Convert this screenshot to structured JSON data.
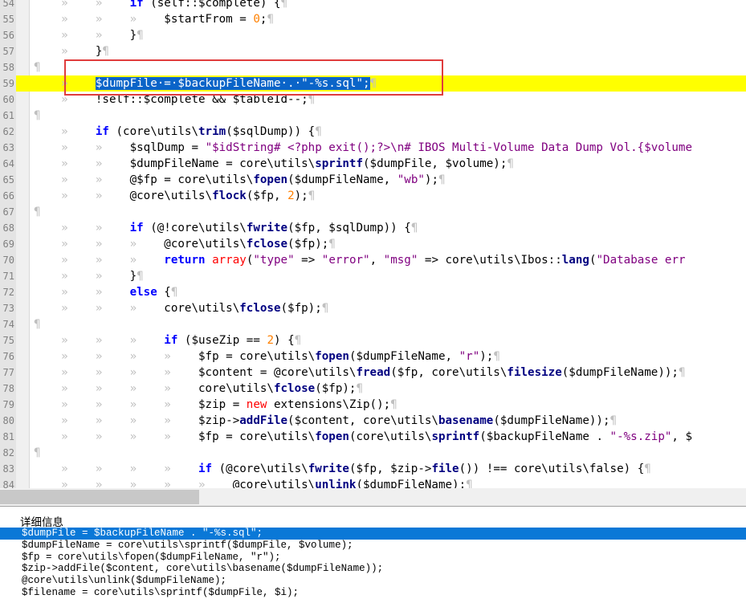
{
  "editor": {
    "lines": [
      {
        "num": "54",
        "tokens": [
          {
            "c": "ws",
            "t": "    »    »    "
          },
          {
            "c": "kw",
            "t": "if"
          },
          {
            "c": "df",
            "t": " (self::$complete) {"
          },
          {
            "c": "ws",
            "t": "¶"
          }
        ]
      },
      {
        "num": "55",
        "tokens": [
          {
            "c": "ws",
            "t": "    »    »    »    "
          },
          {
            "c": "df",
            "t": "$startFrom = "
          },
          {
            "c": "nm",
            "t": "0"
          },
          {
            "c": "df",
            "t": ";"
          },
          {
            "c": "ws",
            "t": "¶"
          }
        ]
      },
      {
        "num": "56",
        "tokens": [
          {
            "c": "ws",
            "t": "    »    »    "
          },
          {
            "c": "df",
            "t": "}"
          },
          {
            "c": "ws",
            "t": "¶"
          }
        ]
      },
      {
        "num": "57",
        "tokens": [
          {
            "c": "ws",
            "t": "    »    "
          },
          {
            "c": "df",
            "t": "}"
          },
          {
            "c": "ws",
            "t": "¶"
          }
        ]
      },
      {
        "num": "58",
        "tokens": [
          {
            "c": "ws",
            "t": "¶"
          }
        ]
      },
      {
        "num": "59",
        "highlight": true,
        "tokens": [
          {
            "c": "ws",
            "t": "    »    "
          },
          {
            "c": "sel",
            "t": "$dumpFile·=·$backupFileName·.·\"-%s.sql\";"
          },
          {
            "c": "ws",
            "t": "¶"
          }
        ]
      },
      {
        "num": "60",
        "tokens": [
          {
            "c": "ws",
            "t": "    »    "
          },
          {
            "c": "df",
            "t": "!self::$complete && $tableId--;"
          },
          {
            "c": "ws",
            "t": "¶"
          }
        ]
      },
      {
        "num": "61",
        "tokens": [
          {
            "c": "ws",
            "t": "¶"
          }
        ]
      },
      {
        "num": "62",
        "tokens": [
          {
            "c": "ws",
            "t": "    »    "
          },
          {
            "c": "kw",
            "t": "if"
          },
          {
            "c": "df",
            "t": " (core\\utils\\"
          },
          {
            "c": "op",
            "t": "trim"
          },
          {
            "c": "df",
            "t": "($sqlDump)) {"
          },
          {
            "c": "ws",
            "t": "¶"
          }
        ]
      },
      {
        "num": "63",
        "tokens": [
          {
            "c": "ws",
            "t": "    »    »    "
          },
          {
            "c": "df",
            "t": "$sqlDump = "
          },
          {
            "c": "sq",
            "t": "\"$idString# <?php exit();?>\\n# IBOS Multi-Volume Data Dump Vol.{$volume"
          }
        ]
      },
      {
        "num": "64",
        "tokens": [
          {
            "c": "ws",
            "t": "    »    »    "
          },
          {
            "c": "df",
            "t": "$dumpFileName = core\\utils\\"
          },
          {
            "c": "op",
            "t": "sprintf"
          },
          {
            "c": "df",
            "t": "($dumpFile, $volume);"
          },
          {
            "c": "ws",
            "t": "¶"
          }
        ]
      },
      {
        "num": "65",
        "tokens": [
          {
            "c": "ws",
            "t": "    »    »    "
          },
          {
            "c": "df",
            "t": "@$fp = core\\utils\\"
          },
          {
            "c": "op",
            "t": "fopen"
          },
          {
            "c": "df",
            "t": "($dumpFileName, "
          },
          {
            "c": "sq",
            "t": "\"wb\""
          },
          {
            "c": "df",
            "t": ");"
          },
          {
            "c": "ws",
            "t": "¶"
          }
        ]
      },
      {
        "num": "66",
        "tokens": [
          {
            "c": "ws",
            "t": "    »    »    "
          },
          {
            "c": "df",
            "t": "@core\\utils\\"
          },
          {
            "c": "op",
            "t": "flock"
          },
          {
            "c": "df",
            "t": "($fp, "
          },
          {
            "c": "nm",
            "t": "2"
          },
          {
            "c": "df",
            "t": ");"
          },
          {
            "c": "ws",
            "t": "¶"
          }
        ]
      },
      {
        "num": "67",
        "tokens": [
          {
            "c": "ws",
            "t": "¶"
          }
        ]
      },
      {
        "num": "68",
        "tokens": [
          {
            "c": "ws",
            "t": "    »    »    "
          },
          {
            "c": "kw",
            "t": "if"
          },
          {
            "c": "df",
            "t": " (@!core\\utils\\"
          },
          {
            "c": "op",
            "t": "fwrite"
          },
          {
            "c": "df",
            "t": "($fp, $sqlDump)) {"
          },
          {
            "c": "ws",
            "t": "¶"
          }
        ]
      },
      {
        "num": "69",
        "tokens": [
          {
            "c": "ws",
            "t": "    »    »    »    "
          },
          {
            "c": "df",
            "t": "@core\\utils\\"
          },
          {
            "c": "op",
            "t": "fclose"
          },
          {
            "c": "df",
            "t": "($fp);"
          },
          {
            "c": "ws",
            "t": "¶"
          }
        ]
      },
      {
        "num": "70",
        "tokens": [
          {
            "c": "ws",
            "t": "    »    »    »    "
          },
          {
            "c": "kw",
            "t": "return"
          },
          {
            "c": "df",
            "t": " "
          },
          {
            "c": "kw2",
            "t": "array"
          },
          {
            "c": "df",
            "t": "("
          },
          {
            "c": "sq",
            "t": "\"type\""
          },
          {
            "c": "df",
            "t": " => "
          },
          {
            "c": "sq",
            "t": "\"error\""
          },
          {
            "c": "df",
            "t": ", "
          },
          {
            "c": "sq",
            "t": "\"msg\""
          },
          {
            "c": "df",
            "t": " => core\\utils\\Ibos::"
          },
          {
            "c": "op",
            "t": "lang"
          },
          {
            "c": "df",
            "t": "("
          },
          {
            "c": "sq",
            "t": "\"Database err"
          }
        ]
      },
      {
        "num": "71",
        "tokens": [
          {
            "c": "ws",
            "t": "    »    »    "
          },
          {
            "c": "df",
            "t": "}"
          },
          {
            "c": "ws",
            "t": "¶"
          }
        ]
      },
      {
        "num": "72",
        "tokens": [
          {
            "c": "ws",
            "t": "    »    »    "
          },
          {
            "c": "kw",
            "t": "else"
          },
          {
            "c": "df",
            "t": " {"
          },
          {
            "c": "ws",
            "t": "¶"
          }
        ]
      },
      {
        "num": "73",
        "tokens": [
          {
            "c": "ws",
            "t": "    »    »    »    "
          },
          {
            "c": "df",
            "t": "core\\utils\\"
          },
          {
            "c": "op",
            "t": "fclose"
          },
          {
            "c": "df",
            "t": "($fp);"
          },
          {
            "c": "ws",
            "t": "¶"
          }
        ]
      },
      {
        "num": "74",
        "tokens": [
          {
            "c": "ws",
            "t": "¶"
          }
        ]
      },
      {
        "num": "75",
        "tokens": [
          {
            "c": "ws",
            "t": "    »    »    »    "
          },
          {
            "c": "kw",
            "t": "if"
          },
          {
            "c": "df",
            "t": " ($useZip == "
          },
          {
            "c": "nm",
            "t": "2"
          },
          {
            "c": "df",
            "t": ") {"
          },
          {
            "c": "ws",
            "t": "¶"
          }
        ]
      },
      {
        "num": "76",
        "tokens": [
          {
            "c": "ws",
            "t": "    »    »    »    »    "
          },
          {
            "c": "df",
            "t": "$fp = core\\utils\\"
          },
          {
            "c": "op",
            "t": "fopen"
          },
          {
            "c": "df",
            "t": "($dumpFileName, "
          },
          {
            "c": "sq",
            "t": "\"r\""
          },
          {
            "c": "df",
            "t": ");"
          },
          {
            "c": "ws",
            "t": "¶"
          }
        ]
      },
      {
        "num": "77",
        "tokens": [
          {
            "c": "ws",
            "t": "    »    »    »    »    "
          },
          {
            "c": "df",
            "t": "$content = @core\\utils\\"
          },
          {
            "c": "op",
            "t": "fread"
          },
          {
            "c": "df",
            "t": "($fp, core\\utils\\"
          },
          {
            "c": "op",
            "t": "filesize"
          },
          {
            "c": "df",
            "t": "($dumpFileName));"
          },
          {
            "c": "ws",
            "t": "¶"
          }
        ]
      },
      {
        "num": "78",
        "tokens": [
          {
            "c": "ws",
            "t": "    »    »    »    »    "
          },
          {
            "c": "df",
            "t": "core\\utils\\"
          },
          {
            "c": "op",
            "t": "fclose"
          },
          {
            "c": "df",
            "t": "($fp);"
          },
          {
            "c": "ws",
            "t": "¶"
          }
        ]
      },
      {
        "num": "79",
        "tokens": [
          {
            "c": "ws",
            "t": "    »    »    »    »    "
          },
          {
            "c": "df",
            "t": "$zip = "
          },
          {
            "c": "kw2",
            "t": "new"
          },
          {
            "c": "df",
            "t": " extensions\\Zip();"
          },
          {
            "c": "ws",
            "t": "¶"
          }
        ]
      },
      {
        "num": "80",
        "tokens": [
          {
            "c": "ws",
            "t": "    »    »    »    »    "
          },
          {
            "c": "df",
            "t": "$zip->"
          },
          {
            "c": "op",
            "t": "addFile"
          },
          {
            "c": "df",
            "t": "($content, core\\utils\\"
          },
          {
            "c": "op",
            "t": "basename"
          },
          {
            "c": "df",
            "t": "($dumpFileName));"
          },
          {
            "c": "ws",
            "t": "¶"
          }
        ]
      },
      {
        "num": "81",
        "tokens": [
          {
            "c": "ws",
            "t": "    »    »    »    »    "
          },
          {
            "c": "df",
            "t": "$fp = core\\utils\\"
          },
          {
            "c": "op",
            "t": "fopen"
          },
          {
            "c": "df",
            "t": "(core\\utils\\"
          },
          {
            "c": "op",
            "t": "sprintf"
          },
          {
            "c": "df",
            "t": "($backupFileName . "
          },
          {
            "c": "sq",
            "t": "\"-%s.zip\""
          },
          {
            "c": "df",
            "t": ", $"
          }
        ]
      },
      {
        "num": "82",
        "tokens": [
          {
            "c": "ws",
            "t": "¶"
          }
        ]
      },
      {
        "num": "83",
        "tokens": [
          {
            "c": "ws",
            "t": "    »    »    »    »    "
          },
          {
            "c": "kw",
            "t": "if"
          },
          {
            "c": "df",
            "t": " (@core\\utils\\"
          },
          {
            "c": "op",
            "t": "fwrite"
          },
          {
            "c": "df",
            "t": "($fp, $zip->"
          },
          {
            "c": "op",
            "t": "file"
          },
          {
            "c": "df",
            "t": "()) !== core\\utils\\false) {"
          },
          {
            "c": "ws",
            "t": "¶"
          }
        ]
      },
      {
        "num": "84",
        "tokens": [
          {
            "c": "ws",
            "t": "    »    »    »    »    »    "
          },
          {
            "c": "df",
            "t": "@core\\utils\\"
          },
          {
            "c": "op",
            "t": "unlink"
          },
          {
            "c": "df",
            "t": "($dumpFileName);"
          },
          {
            "c": "ws",
            "t": "¶"
          }
        ]
      }
    ]
  },
  "details": {
    "title": "详细信息",
    "rows": [
      {
        "text": "$dumpFile = $backupFileName . \"-%s.sql\";",
        "active": true
      },
      {
        "text": "$dumpFileName = core\\utils\\sprintf($dumpFile, $volume);",
        "active": false
      },
      {
        "text": "$fp = core\\utils\\fopen($dumpFileName, \"r\");",
        "active": false
      },
      {
        "text": "$zip->addFile($content, core\\utils\\basename($dumpFileName));",
        "active": false
      },
      {
        "text": "@core\\utils\\unlink($dumpFileName);",
        "active": false
      },
      {
        "text": "$filename = core\\utils\\sprintf($dumpFile, $i);",
        "active": false
      }
    ]
  },
  "colors": {
    "line_highlight": "#ffff00",
    "selection": "#0a64c8",
    "red_box": "#e03c3c",
    "active_row": "#0a78d7"
  }
}
